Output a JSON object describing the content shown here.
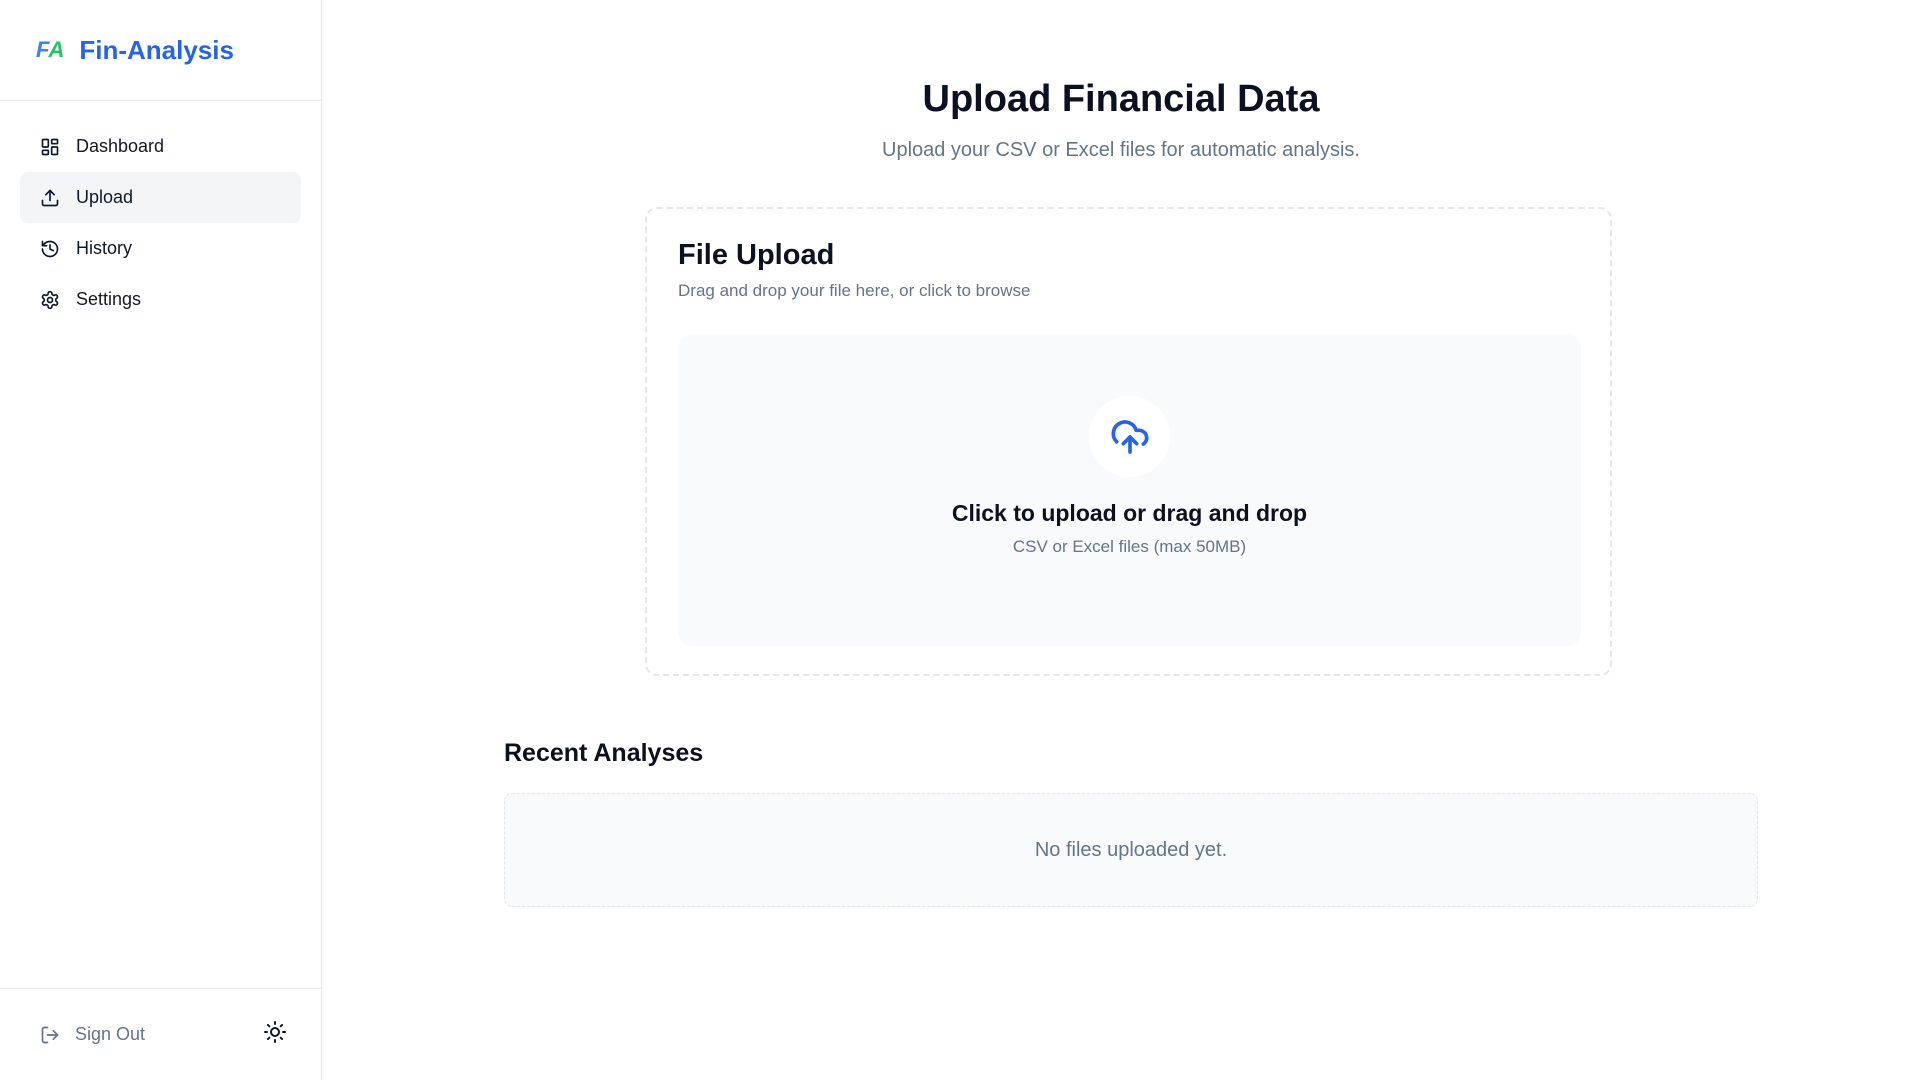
{
  "brand": {
    "logo_f": "F",
    "logo_a": "A",
    "name": "Fin-Analysis"
  },
  "sidebar": {
    "items": [
      {
        "label": "Dashboard",
        "icon": "dashboard-icon",
        "active": false
      },
      {
        "label": "Upload",
        "icon": "upload-icon",
        "active": true
      },
      {
        "label": "History",
        "icon": "history-icon",
        "active": false
      },
      {
        "label": "Settings",
        "icon": "gear-icon",
        "active": false
      }
    ],
    "sign_out_label": "Sign Out",
    "theme_toggle_icon": "sun-icon"
  },
  "main": {
    "title": "Upload Financial Data",
    "subtitle": "Upload your CSV or Excel files for automatic analysis.",
    "upload_card": {
      "title": "File Upload",
      "description": "Drag and drop your file here, or click to browse",
      "dropzone_icon": "cloud-upload-icon",
      "dropzone_title": "Click to upload or drag and drop",
      "dropzone_hint": "CSV or Excel files (max 50MB)"
    },
    "recent": {
      "title": "Recent Analyses",
      "empty_text": "No files uploaded yet."
    }
  },
  "colors": {
    "brand_blue": "#2563eb",
    "logo_green": "#22c55e",
    "muted_text": "#64748b",
    "active_nav_bg": "#f4f5f7",
    "dropzone_bg": "#f9fafb"
  }
}
